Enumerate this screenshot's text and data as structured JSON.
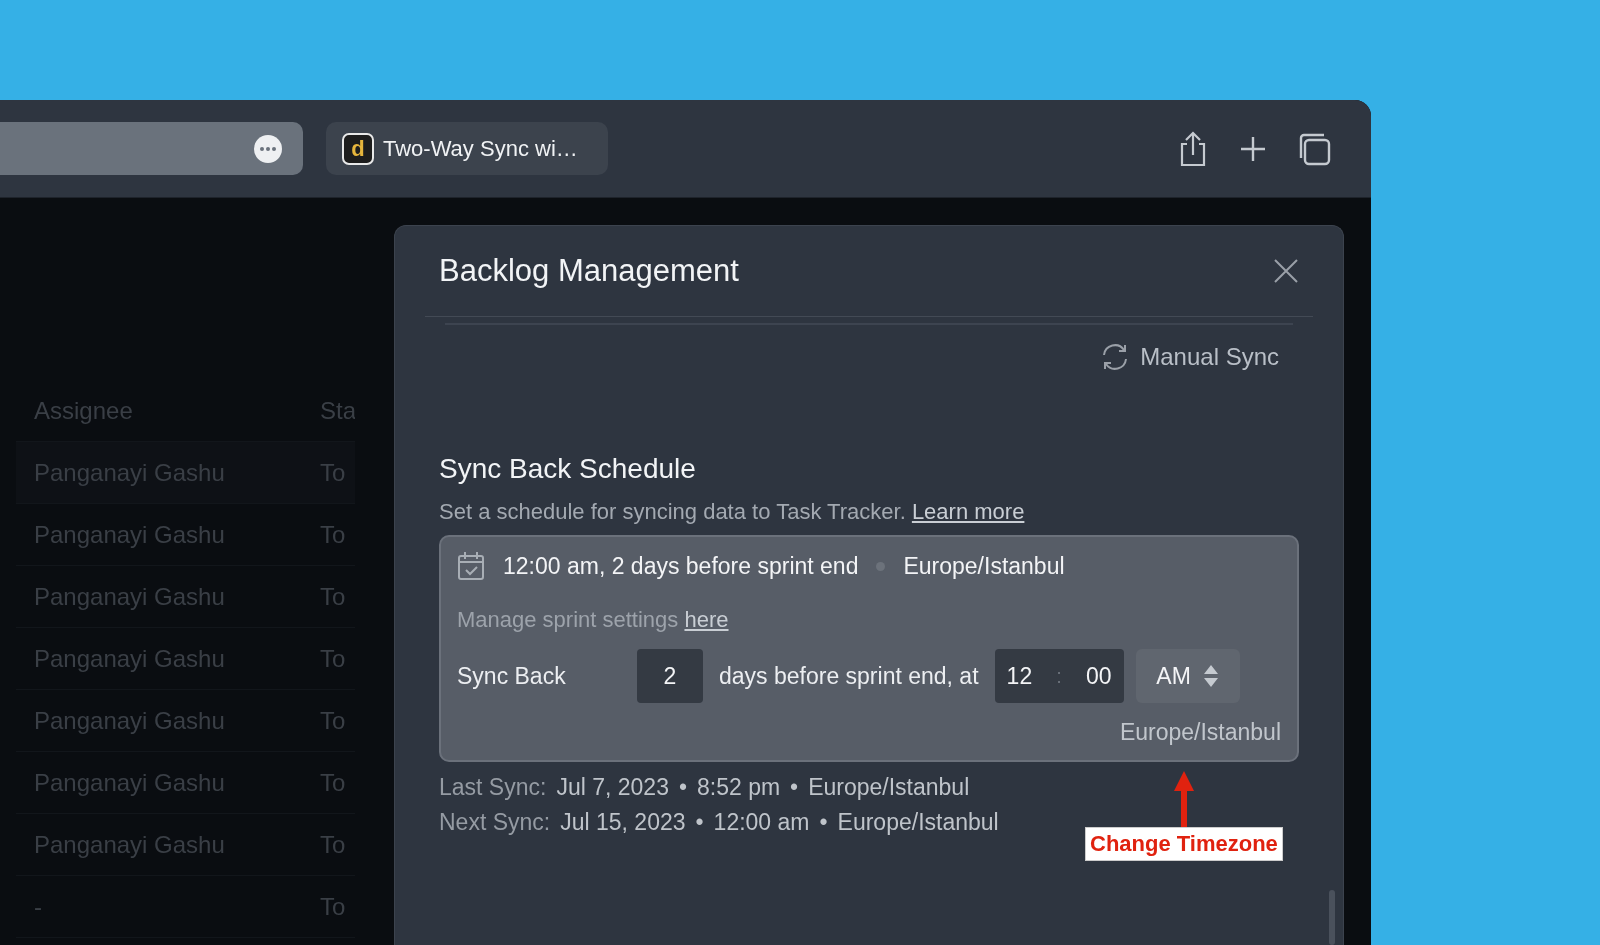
{
  "browser": {
    "tab": {
      "favicon": "d",
      "title": "Two-Way Sync wi…"
    }
  },
  "background_table": {
    "columns": [
      "Assignee",
      "Sta"
    ],
    "rows": [
      {
        "cells": [
          "Panganayi Gashu",
          "To"
        ]
      },
      {
        "cells": [
          "Panganayi Gashu",
          "To"
        ]
      },
      {
        "cells": [
          "Panganayi Gashu",
          "To"
        ]
      },
      {
        "cells": [
          "Panganayi Gashu",
          "To"
        ]
      },
      {
        "cells": [
          "Panganayi Gashu",
          "To"
        ]
      },
      {
        "cells": [
          "Panganayi Gashu",
          "To"
        ]
      },
      {
        "cells": [
          "Panganayi Gashu",
          "To"
        ]
      },
      {
        "cells": [
          "-",
          "To"
        ]
      }
    ]
  },
  "modal": {
    "title": "Backlog Management",
    "manual_sync": "Manual Sync",
    "section_title": "Sync Back Schedule",
    "description": "Set a schedule for syncing data to Task Tracker.",
    "learn_more": "Learn more",
    "summary": {
      "schedule": "12:00 am, 2 days before sprint end",
      "timezone": "Europe/Istanbul"
    },
    "manage_text": "Manage sprint settings",
    "manage_link": "here",
    "sync_back": {
      "label": "Sync Back",
      "days": "2",
      "middle": "days before sprint end, at",
      "hour": "12",
      "separator": ":",
      "minute": "00",
      "period": "AM"
    },
    "timezone": "Europe/Istanbul",
    "sync_lines": [
      {
        "label": "Last Sync:",
        "parts": [
          "Jul 7, 2023",
          "•",
          "8:52 pm",
          "•",
          "Europe/Istanbul"
        ]
      },
      {
        "label": "Next Sync:",
        "parts": [
          "Jul 15, 2023",
          "•",
          "12:00 am",
          "•",
          "Europe/Istanbul"
        ]
      }
    ]
  },
  "annotation": {
    "label": "Change Timezone"
  }
}
